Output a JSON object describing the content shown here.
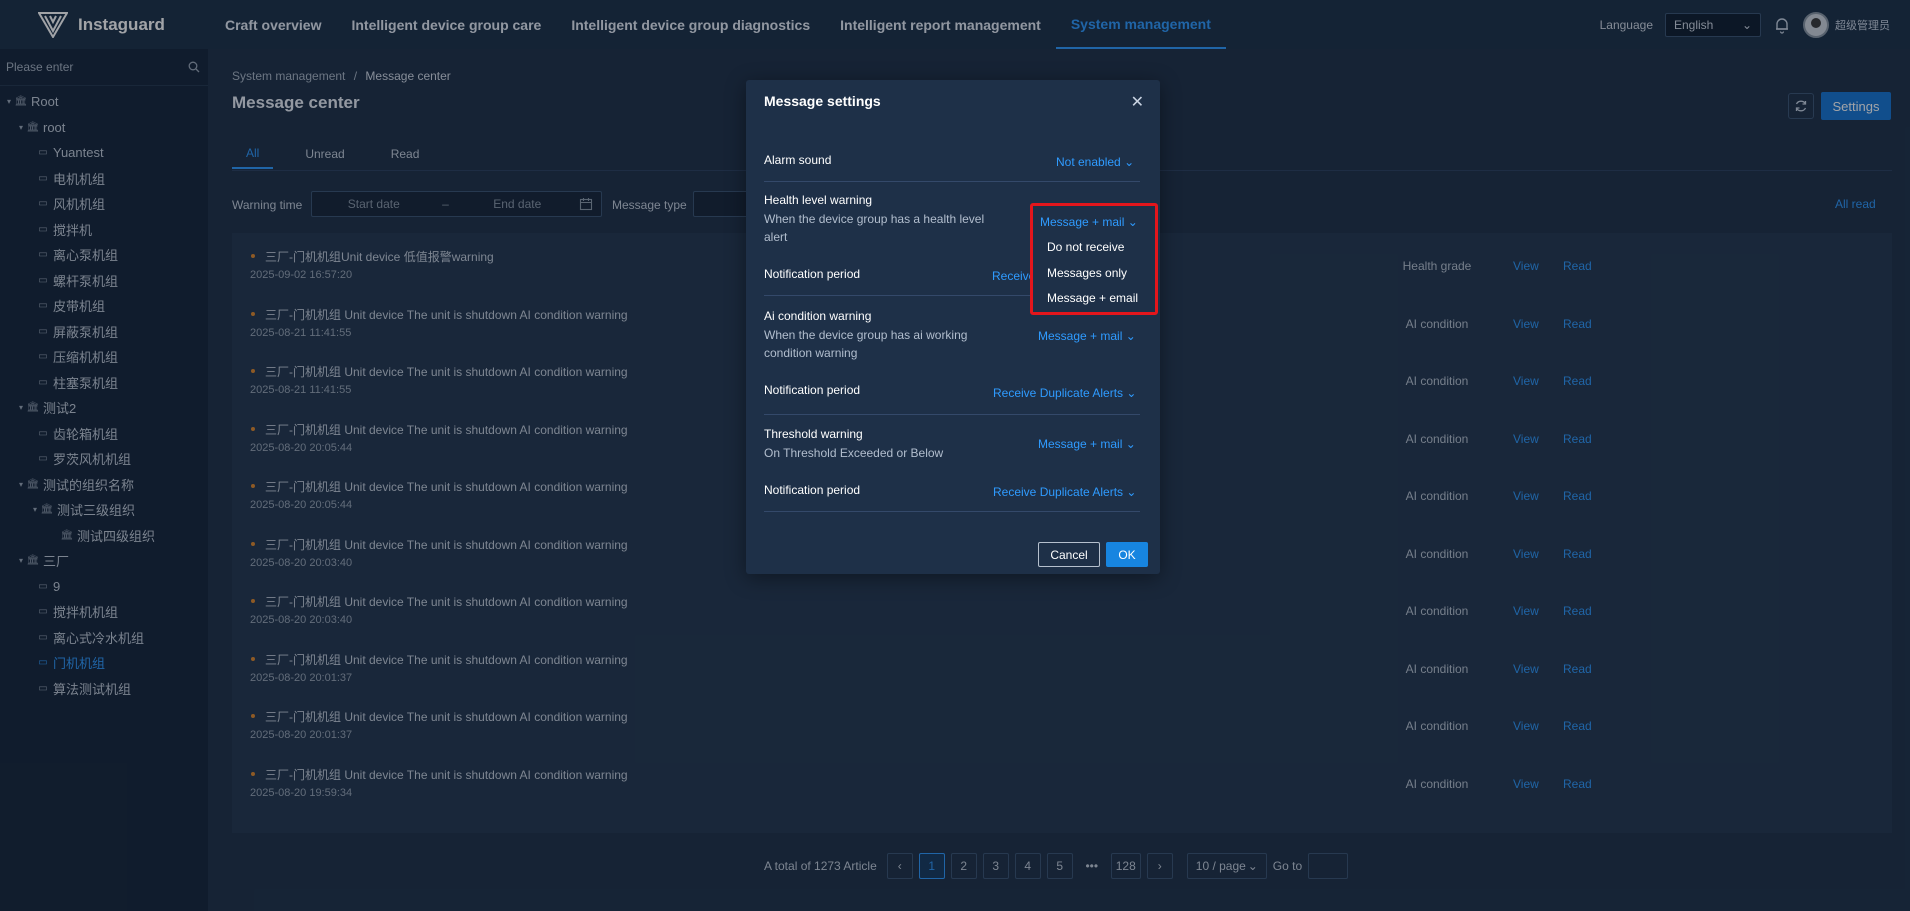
{
  "app": {
    "name": "Instaguard"
  },
  "nav": [
    "Craft overview",
    "Intelligent device group care",
    "Intelligent device group diagnostics",
    "Intelligent report management",
    "System management"
  ],
  "header": {
    "language_label": "Language",
    "language_value": "English",
    "user_name": "超级管理员"
  },
  "sidebar": {
    "search_placeholder": "Please enter",
    "tree": [
      {
        "label": "Root",
        "toggle": "▾",
        "icon": "🏛"
      },
      {
        "label": "root",
        "toggle": "▾",
        "icon": "🏛"
      },
      {
        "label": "Yuantest",
        "toggle": "",
        "icon": "▭"
      },
      {
        "label": "电机机组",
        "toggle": "",
        "icon": "▭"
      },
      {
        "label": "风机机组",
        "toggle": "",
        "icon": "▭"
      },
      {
        "label": "搅拌机",
        "toggle": "",
        "icon": "▭"
      },
      {
        "label": "离心泵机组",
        "toggle": "",
        "icon": "▭"
      },
      {
        "label": "螺杆泵机组",
        "toggle": "",
        "icon": "▭"
      },
      {
        "label": "皮带机组",
        "toggle": "",
        "icon": "▭"
      },
      {
        "label": "屏蔽泵机组",
        "toggle": "",
        "icon": "▭"
      },
      {
        "label": "压缩机机组",
        "toggle": "",
        "icon": "▭"
      },
      {
        "label": "柱塞泵机组",
        "toggle": "",
        "icon": "▭"
      },
      {
        "label": "测试2",
        "toggle": "▾",
        "icon": "🏛"
      },
      {
        "label": "齿轮箱机组",
        "toggle": "",
        "icon": "▭"
      },
      {
        "label": "罗茨风机机组",
        "toggle": "",
        "icon": "▭"
      },
      {
        "label": "测试的组织名称",
        "toggle": "▾",
        "icon": "🏛"
      },
      {
        "label": "测试三级组织",
        "toggle": "▾",
        "icon": "🏛"
      },
      {
        "label": "测试四级组织",
        "toggle": "",
        "icon": "🏛"
      },
      {
        "label": "三厂",
        "toggle": "▾",
        "icon": "🏛"
      },
      {
        "label": "9",
        "toggle": "",
        "icon": "▭"
      },
      {
        "label": "搅拌机机组",
        "toggle": "",
        "icon": "▭"
      },
      {
        "label": "离心式冷水机组",
        "toggle": "",
        "icon": "▭"
      },
      {
        "label": "门机机组",
        "toggle": "",
        "icon": "▭"
      },
      {
        "label": "算法测试机组",
        "toggle": "",
        "icon": "▭"
      }
    ]
  },
  "main": {
    "breadcrumb_parent": "System management",
    "breadcrumb_sep": "/",
    "breadcrumb_current": "Message center",
    "title": "Message center",
    "settings_label": "Settings",
    "tabs": [
      "All",
      "Unread",
      "Read"
    ],
    "filters": {
      "warning_time_label": "Warning time",
      "start_placeholder": "Start date",
      "range_sep": "–",
      "end_placeholder": "End date",
      "type_label": "Message type"
    },
    "all_read_label": "All read",
    "messages": [
      {
        "title": "三厂-门机机组Unit device 低值报警warning",
        "time": "2025-09-02 16:57:20",
        "type": "Health grade",
        "view": "View",
        "read": "Read"
      },
      {
        "title": "三厂-门机机组 Unit device The unit is shutdown AI condition warning",
        "time": "2025-08-21 11:41:55",
        "type": "AI condition",
        "view": "View",
        "read": "Read"
      },
      {
        "title": "三厂-门机机组 Unit device The unit is shutdown AI condition warning",
        "time": "2025-08-21 11:41:55",
        "type": "AI condition",
        "view": "View",
        "read": "Read"
      },
      {
        "title": "三厂-门机机组 Unit device The unit is shutdown AI condition warning",
        "time": "2025-08-20 20:05:44",
        "type": "AI condition",
        "view": "View",
        "read": "Read"
      },
      {
        "title": "三厂-门机机组 Unit device The unit is shutdown AI condition warning",
        "time": "2025-08-20 20:05:44",
        "type": "AI condition",
        "view": "View",
        "read": "Read"
      },
      {
        "title": "三厂-门机机组 Unit device The unit is shutdown AI condition warning",
        "time": "2025-08-20 20:03:40",
        "type": "AI condition",
        "view": "View",
        "read": "Read"
      },
      {
        "title": "三厂-门机机组 Unit device The unit is shutdown AI condition warning",
        "time": "2025-08-20 20:03:40",
        "type": "AI condition",
        "view": "View",
        "read": "Read"
      },
      {
        "title": "三厂-门机机组 Unit device The unit is shutdown AI condition warning",
        "time": "2025-08-20 20:01:37",
        "type": "AI condition",
        "view": "View",
        "read": "Read"
      },
      {
        "title": "三厂-门机机组 Unit device The unit is shutdown AI condition warning",
        "time": "2025-08-20 20:01:37",
        "type": "AI condition",
        "view": "View",
        "read": "Read"
      },
      {
        "title": "三厂-门机机组 Unit device The unit is shutdown AI condition warning",
        "time": "2025-08-20 19:59:34",
        "type": "AI condition",
        "view": "View",
        "read": "Read"
      }
    ],
    "pagination": {
      "total_text": "A total of 1273 Article",
      "pages": [
        "1",
        "2",
        "3",
        "4",
        "5",
        "•••",
        "128"
      ],
      "current_page": "1",
      "page_size": "10 / page",
      "goto_label": "Go to"
    }
  },
  "modal": {
    "title": "Message settings",
    "alarm_sound_label": "Alarm sound",
    "alarm_sound_value": "Not enabled",
    "health_label": "Health level warning",
    "health_desc": "When the device group has a health level alert",
    "health_value": "Message + mail",
    "health_period_label": "Notification period",
    "health_period_value": "Receive",
    "ai_label": "Ai condition warning",
    "ai_desc": "When the device group has ai working condition warning",
    "ai_value": "Message + mail",
    "ai_period_label": "Notification period",
    "ai_period_value": "Receive Duplicate Alerts",
    "threshold_label": "Threshold warning",
    "threshold_desc": "On Threshold Exceeded or Below",
    "threshold_value": "Message + mail",
    "threshold_period_label": "Notification period",
    "threshold_period_value": "Receive Duplicate Alerts",
    "cancel_label": "Cancel",
    "ok_label": "OK",
    "dropdown": {
      "selected": "Message + mail",
      "options": [
        "Do not receive",
        "Messages only",
        "Message + email"
      ]
    }
  },
  "colors": {
    "accent": "#2f9bff",
    "topbar": "#1c3148",
    "highlight": "#e4161c",
    "dot": "#e08a2e"
  }
}
